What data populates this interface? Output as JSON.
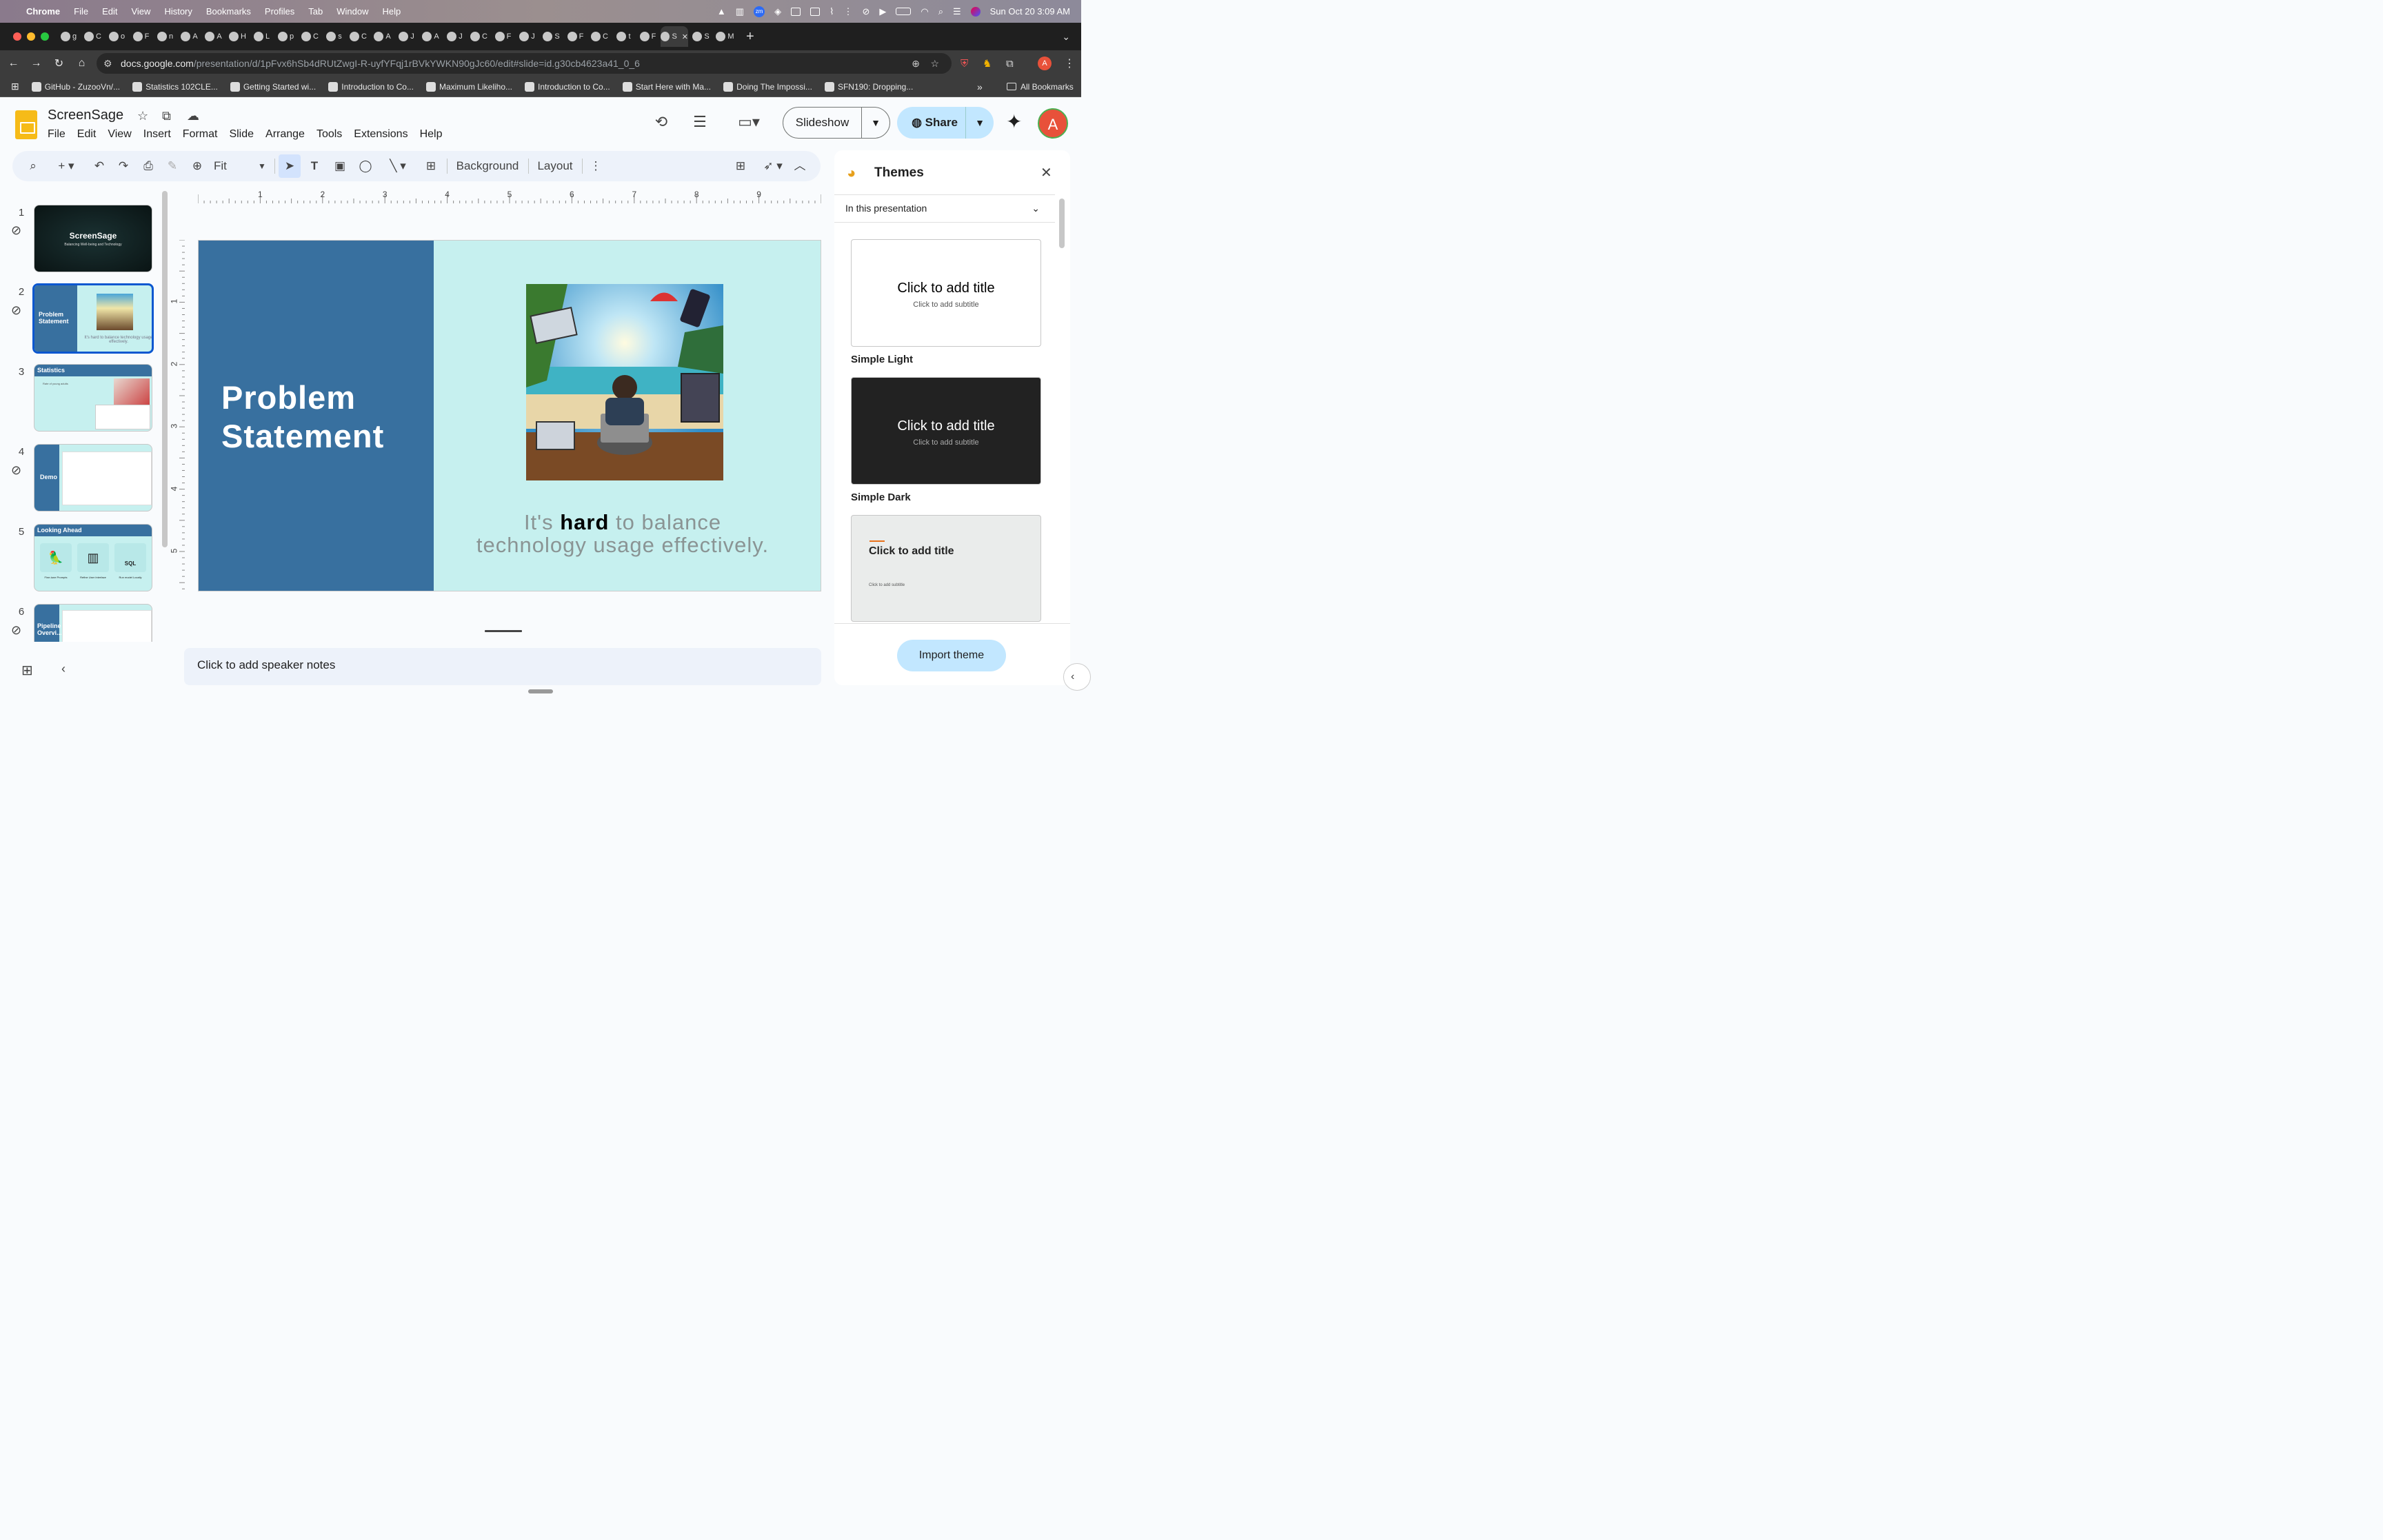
{
  "menubar": {
    "app": "Chrome",
    "items": [
      "File",
      "Edit",
      "View",
      "History",
      "Bookmarks",
      "Profiles",
      "Tab",
      "Window",
      "Help"
    ],
    "datetime": "Sun Oct 20  3:09 AM"
  },
  "tabs": [
    "g",
    "C",
    "o",
    "F",
    "n",
    "A",
    "A",
    "H",
    "L",
    "p",
    "C",
    "s",
    "C",
    "A",
    "J",
    "A",
    "J",
    "C",
    "F",
    "J",
    "S",
    "F",
    "C",
    "t",
    "F",
    "S",
    "S",
    "M"
  ],
  "address": {
    "host": "docs.google.com",
    "path": "/presentation/d/1pFvx6hSb4dRUtZwgI-R-uyfYFqj1rBVkYWKN90gJc60/edit#slide=id.g30cb4623a41_0_6"
  },
  "bookmarks": [
    "GitHub - ZuzooVn/...",
    "Statistics 102CLE...",
    "Getting Started wi...",
    "Introduction to Co...",
    "Maximum Likeliho...",
    "Introduction to Co...",
    "Start Here with Ma...",
    "Doing The Impossi...",
    "SFN190: Dropping..."
  ],
  "all_bookmarks": "All Bookmarks",
  "doc": {
    "title": "ScreenSage",
    "menus": [
      "File",
      "Edit",
      "View",
      "Insert",
      "Format",
      "Slide",
      "Arrange",
      "Tools",
      "Extensions",
      "Help"
    ]
  },
  "header": {
    "slideshow": "Slideshow",
    "share": "Share",
    "avatar": "A"
  },
  "toolbar": {
    "zoom": "Fit",
    "background": "Background",
    "layout": "Layout"
  },
  "filmstrip": [
    {
      "num": "1",
      "title": "ScreenSage",
      "subtitle": "Balancing Well-being and Technology"
    },
    {
      "num": "2",
      "title": "Problem Statement",
      "caption": "It's hard to balance technology usage effectively."
    },
    {
      "num": "3",
      "title": "Statistics",
      "caption": "Rate of young adults"
    },
    {
      "num": "4",
      "title": "Demo"
    },
    {
      "num": "5",
      "title": "Looking Ahead",
      "items": [
        "Fine-tune Prompts",
        "Refine User Interface",
        "Run model Locally"
      ],
      "icon_text": "SQL"
    },
    {
      "num": "6",
      "title": "Pipeline Overvi..."
    }
  ],
  "ruler": {
    "h": [
      "1",
      "2",
      "3",
      "4",
      "5",
      "6",
      "7",
      "8",
      "9"
    ],
    "v": [
      "1",
      "2",
      "3",
      "4",
      "5"
    ]
  },
  "slide": {
    "title_line1": "Problem",
    "title_line2": "Statement",
    "caption_pre": "It's ",
    "caption_bold": "hard",
    "caption_mid": " to balance",
    "caption_line2": "technology usage effectively.",
    "image": "stressed-person-with-devices-beach-illustration"
  },
  "notes": {
    "placeholder": "Click to add speaker notes"
  },
  "themes": {
    "title": "Themes",
    "filter": "In this presentation",
    "cards": [
      {
        "name": "Simple Light",
        "title": "Click to add title",
        "subtitle": "Click to add subtitle"
      },
      {
        "name": "Simple Dark",
        "title": "Click to add title",
        "subtitle": "Click to add subtitle"
      },
      {
        "name": "",
        "title": "Click to add title",
        "subtitle": "Click to add subtitle"
      }
    ],
    "import": "Import theme"
  },
  "colors": {
    "accent": "#0b57d0",
    "share_bg": "#c2e7ff",
    "slide_left": "#38709f",
    "slide_right": "#c6f0ef"
  }
}
